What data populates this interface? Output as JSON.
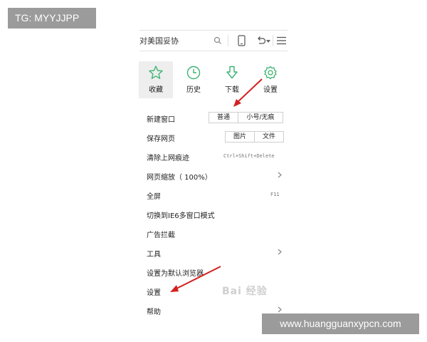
{
  "watermarks": {
    "top_left": "TG: MYYJJPP",
    "bottom_right": "www.huangguanxypcn.com",
    "baidu": "Bai 经验"
  },
  "toolbar": {
    "address_text": "对美国妥协",
    "icons": [
      "search-icon",
      "phone-icon",
      "undo-icon",
      "caret-down-icon",
      "hamburger-menu-icon"
    ]
  },
  "quick_actions": [
    {
      "label": "收藏",
      "icon": "star-icon",
      "selected": true
    },
    {
      "label": "历史",
      "icon": "clock-icon"
    },
    {
      "label": "下载",
      "icon": "download-arrow-icon"
    },
    {
      "label": "设置",
      "icon": "gear-icon"
    }
  ],
  "menu": {
    "new_window": {
      "label": "新建窗口",
      "options": [
        "普通",
        "小号/无痕"
      ]
    },
    "save_page": {
      "label": "保存网页",
      "options": [
        "图片",
        "文件"
      ]
    },
    "clear_traces": {
      "label": "清除上网痕迹",
      "shortcut": "Ctrl+Shift+Delete"
    },
    "zoom": {
      "label": "网页缩放（ 100%）"
    },
    "fullscreen": {
      "label": "全屏",
      "shortcut": "F11"
    },
    "ie6_mode": {
      "label": "切换到IE6多窗口模式"
    },
    "ad_block": {
      "label": "广告拦截"
    },
    "tools": {
      "label": "工具"
    },
    "default_browser": {
      "label": "设置为默认浏览器"
    },
    "settings": {
      "label": "设置"
    },
    "help": {
      "label": "帮助"
    }
  },
  "colors": {
    "accent": "#3cb371",
    "annotation_arrow": "#d42020"
  }
}
